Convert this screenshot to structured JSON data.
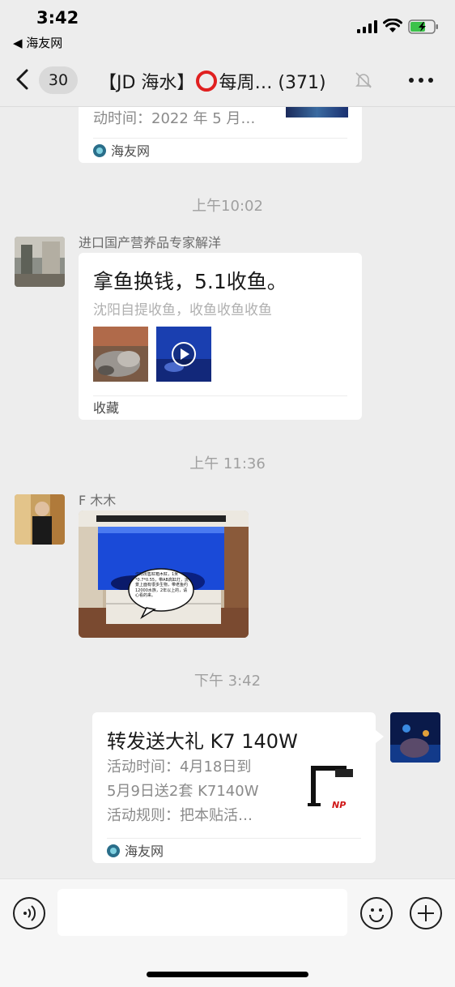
{
  "status_bar": {
    "time": "3:42",
    "back_app": "◀ 海友网"
  },
  "nav": {
    "unread_count": "30",
    "title_prefix": "【JD 海水】",
    "title_suffix": "每周… (371)"
  },
  "messages": {
    "card_top": {
      "partial_text": "动时间：2022 年 5 月…",
      "source": "海友网"
    },
    "ts1": "上午10:02",
    "msg1": {
      "sender": "进口国产营养品专家解洋",
      "title": "拿鱼换钱，5.1收鱼。",
      "subtitle": "沈阳自提收鱼，收鱼收鱼收鱼",
      "footer": "收藏"
    },
    "ts2": "上午 11:36",
    "msg2": {
      "sender": "F 木木",
      "bubble_text": "沈阳出售缸箱木缸，1米*0.7*0.55，带AB高缸灯，流景上面有很多生物，带老鱼约12000水族，2年以上的，请心看的来。"
    },
    "ts3": "下午 3:42",
    "msg3": {
      "title": "转发送大礼 K7 140W",
      "line1": "活动时间：4月18日到",
      "line2": "5月9日送2套 K7140W",
      "line3": "活动规则：把本贴活…",
      "source": "海友网",
      "logo_text": "NP"
    }
  },
  "input_bar": {
    "placeholder": ""
  },
  "colors": {
    "background": "#ededed",
    "card": "#ffffff",
    "muted": "#a0a0a0",
    "ring": "#e02020"
  }
}
